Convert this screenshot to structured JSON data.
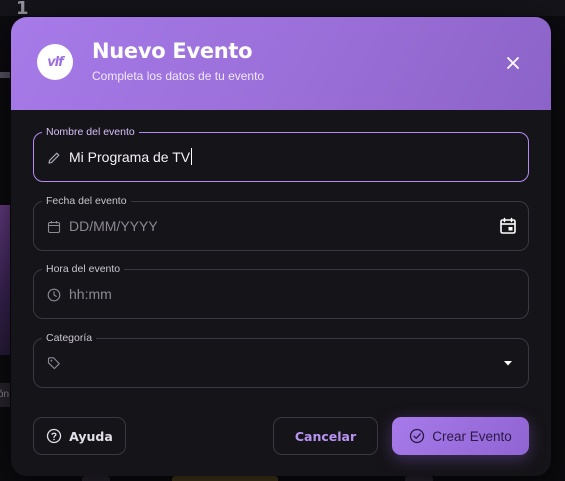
{
  "background": {
    "top_number": "1",
    "side_tag": "ón"
  },
  "modal": {
    "logo_text": "vlf",
    "title": "Nuevo Evento",
    "subtitle": "Completa los datos de tu evento"
  },
  "fields": {
    "name": {
      "label": "Nombre del evento",
      "value": "Mi Programa de TV",
      "icon": "pencil-icon"
    },
    "date": {
      "label": "Fecha del evento",
      "placeholder": "DD/MM/YYYY",
      "icon": "calendar-icon",
      "trailing_icon": "calendar-picker-icon"
    },
    "time": {
      "label": "Hora del evento",
      "placeholder": "hh:mm",
      "icon": "clock-icon"
    },
    "category": {
      "label": "Categoría",
      "value": "",
      "icon": "tag-icon",
      "trailing_icon": "dropdown-arrow-icon"
    }
  },
  "actions": {
    "help_label": "Ayuda",
    "cancel_label": "Cancelar",
    "create_label": "Crear Evento"
  },
  "colors": {
    "accent": "#a67ae8",
    "focus_border": "#b48cf0",
    "modal_bg": "#151418"
  }
}
